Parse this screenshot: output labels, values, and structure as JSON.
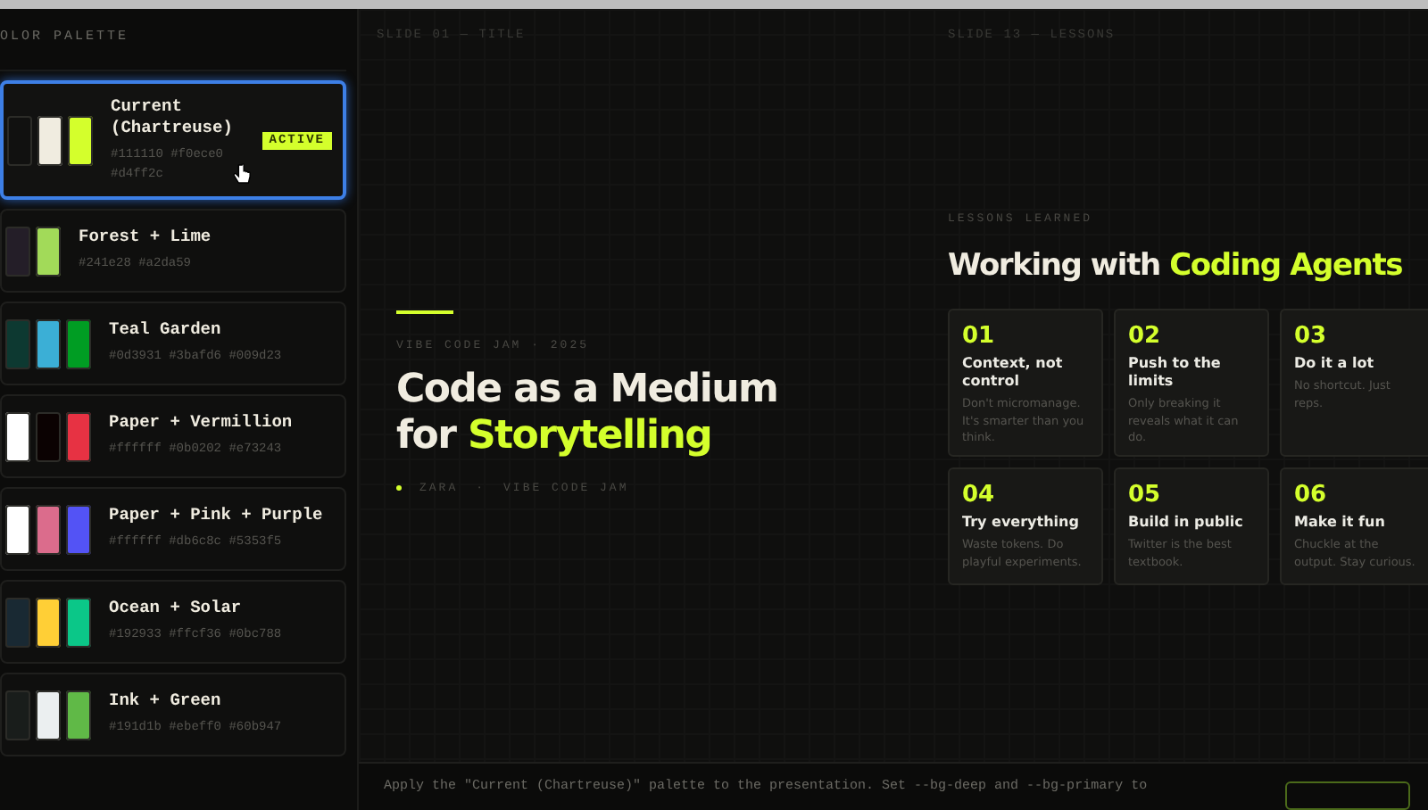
{
  "sidebar": {
    "heading": "OLOR PALETTE",
    "palettes": [
      {
        "name": "Current (Chartreuse)",
        "selected": true,
        "badge": "ACTIVE",
        "swatches": [
          {
            "color": "#111110"
          },
          {
            "color": "#f0ece0"
          },
          {
            "color": "#d4ff2c"
          }
        ],
        "codes": "#111110 #f0ece0 #d4ff2c"
      },
      {
        "name": "Forest + Lime",
        "selected": false,
        "swatches": [
          {
            "color": "#241e28"
          },
          {
            "color": "#a2da59"
          }
        ],
        "codes": "#241e28 #a2da59"
      },
      {
        "name": "Teal Garden",
        "selected": false,
        "swatches": [
          {
            "color": "#0d3931"
          },
          {
            "color": "#3bafd6"
          },
          {
            "color": "#009d23"
          }
        ],
        "codes": "#0d3931 #3bafd6 #009d23"
      },
      {
        "name": "Paper + Vermillion",
        "selected": false,
        "swatches": [
          {
            "color": "#ffffff"
          },
          {
            "color": "#0b0202"
          },
          {
            "color": "#e73243"
          }
        ],
        "codes": "#ffffff #0b0202 #e73243"
      },
      {
        "name": "Paper + Pink + Purple",
        "selected": false,
        "swatches": [
          {
            "color": "#ffffff"
          },
          {
            "color": "#db6c8c"
          },
          {
            "color": "#5353f5"
          }
        ],
        "codes": "#ffffff #db6c8c #5353f5"
      },
      {
        "name": "Ocean + Solar",
        "selected": false,
        "swatches": [
          {
            "color": "#192933"
          },
          {
            "color": "#ffcf36"
          },
          {
            "color": "#0bc788"
          }
        ],
        "codes": "#192933 #ffcf36 #0bc788"
      },
      {
        "name": "Ink + Green",
        "selected": false,
        "swatches": [
          {
            "color": "#191d1b"
          },
          {
            "color": "#ebeff0"
          },
          {
            "color": "#60b947"
          }
        ],
        "codes": "#191d1b #ebeff0 #60b947"
      }
    ]
  },
  "slides": [
    {
      "kind": "title",
      "label": "SLIDE 01 — TITLE",
      "eyebrow": "VIBE CODE JAM · 2025",
      "title": "Code as a Medium for",
      "title_accent": "Storytelling",
      "meta": [
        "ZARA",
        "·",
        "VIBE CODE JAM"
      ]
    },
    {
      "kind": "lessons",
      "label": "SLIDE 13 — LESSONS",
      "eyebrow": "LESSONS LEARNED",
      "title": "Working with",
      "title_accent": "Coding Agents",
      "cards": [
        {
          "number": "01",
          "title": "Context, not control",
          "text": "Don't micromanage. It's smarter than you think."
        },
        {
          "number": "02",
          "title": "Push to the limits",
          "text": "Only breaking it reveals what it can do."
        },
        {
          "number": "03",
          "title": "Do it a lot",
          "text": "No shortcut. Just reps."
        },
        {
          "number": "04",
          "title": "Try everything",
          "text": "Waste tokens. Do playful experiments."
        },
        {
          "number": "05",
          "title": "Build in public",
          "text": "Twitter is the best textbook."
        },
        {
          "number": "06",
          "title": "Make it fun",
          "text": "Chuckle at the output. Stay curious."
        }
      ]
    }
  ],
  "prompt": {
    "text": "Apply the \"Current (Chartreuse)\" palette to the presentation. Set --bg-deep and --bg-primary to"
  }
}
